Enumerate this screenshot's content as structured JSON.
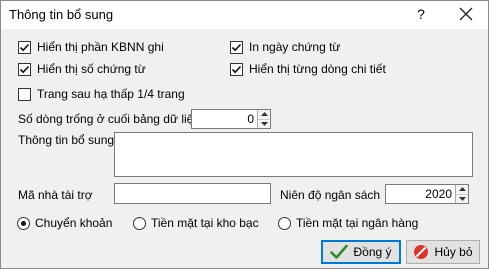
{
  "window": {
    "title": "Thông tin bổ sung",
    "help_glyph": "?"
  },
  "options": {
    "show_kbnn_part": {
      "label": "Hiển thị phần KBNN ghi",
      "checked": true
    },
    "print_date": {
      "label": "In ngày chứng từ",
      "checked": true
    },
    "show_doc_number": {
      "label": "Hiển thị số chứng từ",
      "checked": true
    },
    "show_detail_lines": {
      "label": "Hiển thị từng dòng chi tiết",
      "checked": true
    },
    "page_drop_quarter": {
      "label": "Trang sau hạ thấp 1/4 trang",
      "checked": false
    }
  },
  "blank_rows": {
    "label": "Số dòng trống ở cuối bảng dữ liệu",
    "value": "0"
  },
  "extra_info": {
    "label": "Thông tin bổ sung",
    "value": ""
  },
  "sponsor_code": {
    "label": "Mã nhà tài trợ",
    "value": ""
  },
  "budget_year": {
    "label": "Niên độ ngân sách",
    "value": "2020"
  },
  "payment": {
    "options": [
      {
        "label": "Chuyển khoản",
        "selected": true
      },
      {
        "label": "Tiền mặt tại kho bạc",
        "selected": false
      },
      {
        "label": "Tiền mặt tại ngân hàng",
        "selected": false
      }
    ]
  },
  "buttons": {
    "ok": "Đồng ý",
    "cancel": "Hủy bỏ"
  },
  "colors": {
    "accent": "#0078d7",
    "check_green": "#2e8b2e",
    "cancel_red": "#d9352b"
  }
}
